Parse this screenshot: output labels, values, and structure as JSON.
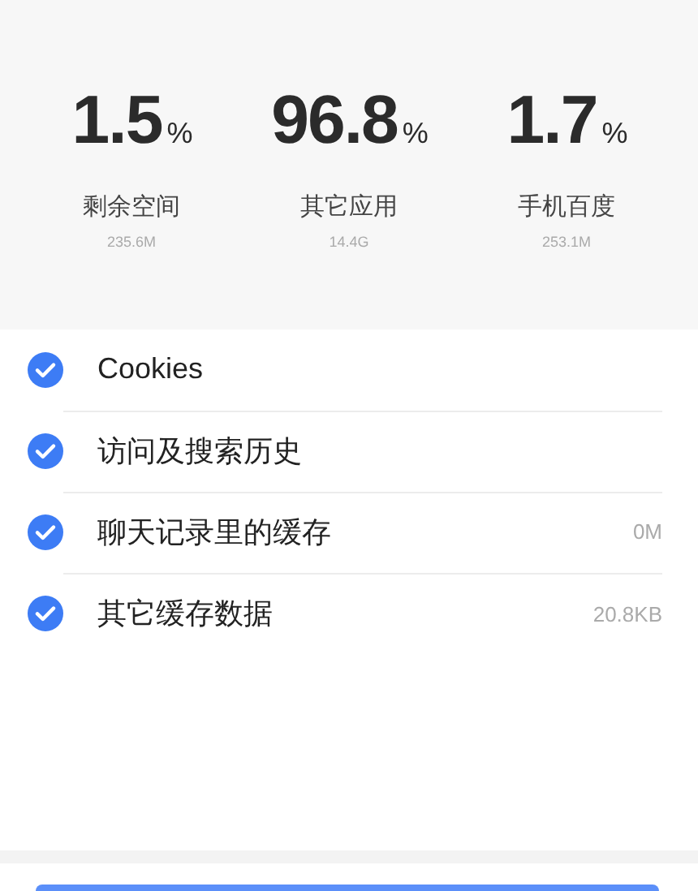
{
  "stats": [
    {
      "value": "1.5",
      "unit": "%",
      "label": "剩余空间",
      "size": "235.6M"
    },
    {
      "value": "96.8",
      "unit": "%",
      "label": "其它应用",
      "size": "14.4G"
    },
    {
      "value": "1.7",
      "unit": "%",
      "label": "手机百度",
      "size": "253.1M"
    }
  ],
  "items": [
    {
      "label": "Cookies",
      "checked": true
    },
    {
      "label": "访问及搜索历史",
      "checked": true
    },
    {
      "label": "聊天记录里的缓存",
      "checked": true,
      "size": "0M"
    },
    {
      "label": "其它缓存数据",
      "checked": true,
      "size": "20.8KB"
    }
  ]
}
